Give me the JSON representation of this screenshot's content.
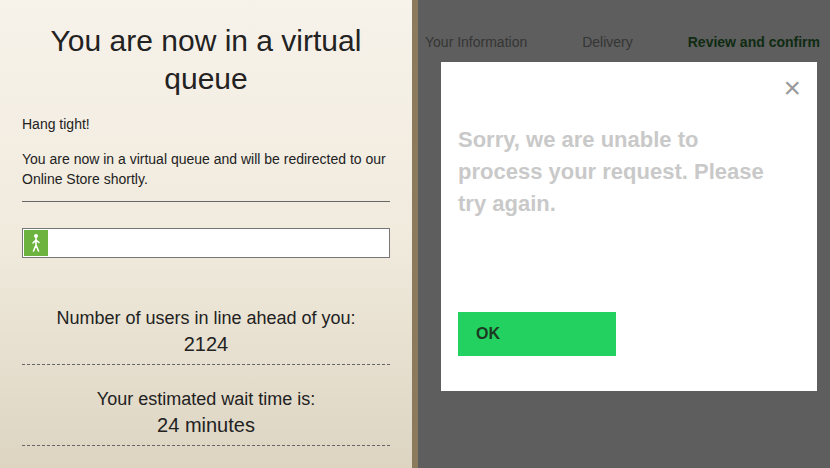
{
  "queue": {
    "title": "You are now in a virtual queue",
    "greeting": "Hang tight!",
    "message": "You are now in a virtual queue and will be redirected to our Online Store shortly.",
    "progress": {
      "level": 0.03
    },
    "stats": [
      {
        "label": "Number of users in line ahead of you:",
        "value": "2124"
      },
      {
        "label": "Your estimated wait time is:",
        "value": "24 minutes"
      }
    ]
  },
  "checkout": {
    "steps": [
      {
        "label": "Your Information",
        "selected": false
      },
      {
        "label": "Delivery",
        "selected": false
      },
      {
        "label": "Review and confirm",
        "selected": true
      }
    ],
    "dialog": {
      "close": "×",
      "message": "Sorry, we are unable to process your request. Please try again.",
      "buttons": [
        "OK"
      ]
    }
  }
}
